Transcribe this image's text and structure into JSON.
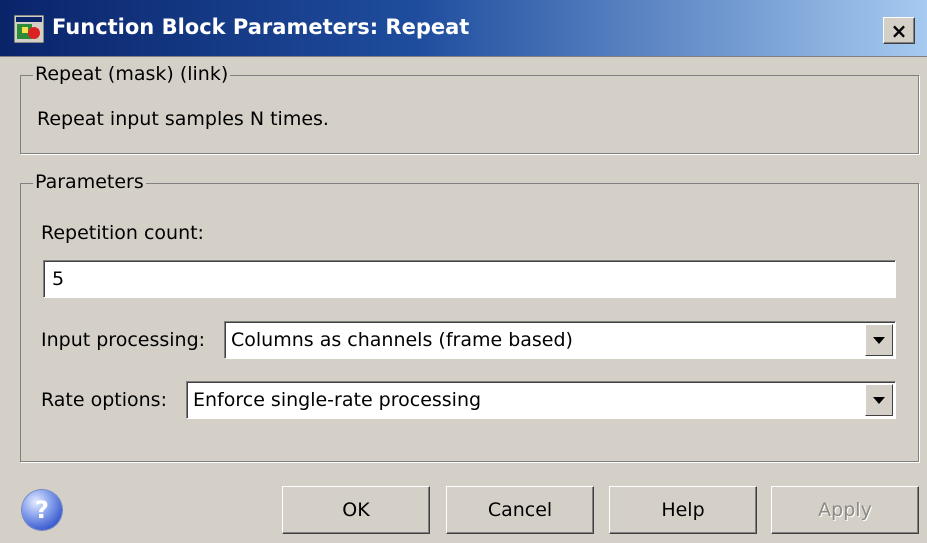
{
  "window": {
    "title": "Function Block Parameters: Repeat",
    "close_glyph": "×",
    "app_icon": "simulink-block-icon"
  },
  "description": {
    "legend": "Repeat (mask) (link)",
    "text": "Repeat input samples N times."
  },
  "parameters": {
    "legend": "Parameters",
    "repetition_count_label": "Repetition count:",
    "repetition_count_value": "5",
    "input_processing_label": "Input processing:",
    "input_processing_value": "Columns as channels (frame based)",
    "rate_options_label": "Rate options:",
    "rate_options_value": "Enforce single-rate processing"
  },
  "buttons": {
    "help_icon_glyph": "?",
    "ok": "OK",
    "cancel": "Cancel",
    "help": "Help",
    "apply": "Apply",
    "apply_disabled": true
  },
  "colors": {
    "titlebar_start": "#0a246a",
    "titlebar_end": "#a6caf0",
    "dialog_bg": "#d4d0c8"
  }
}
